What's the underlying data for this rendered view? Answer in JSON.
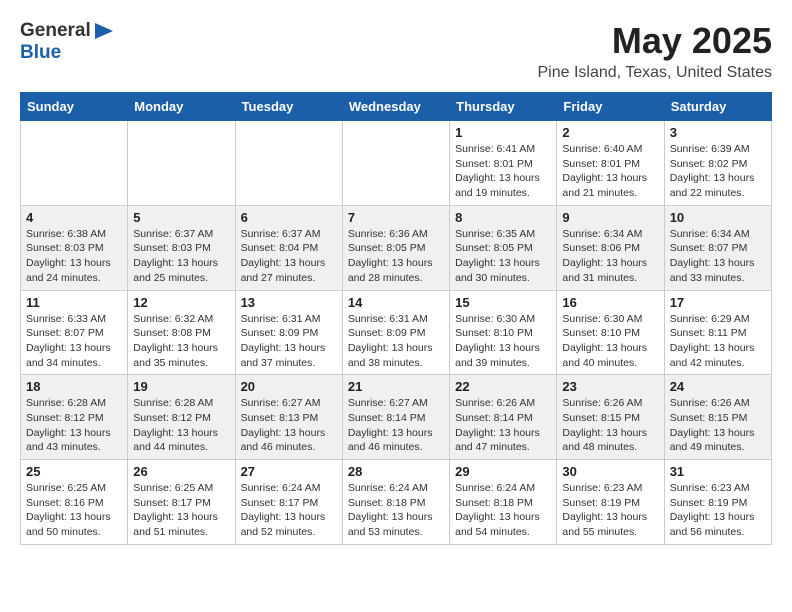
{
  "header": {
    "logo_general": "General",
    "logo_blue": "Blue",
    "title": "May 2025",
    "subtitle": "Pine Island, Texas, United States"
  },
  "weekdays": [
    "Sunday",
    "Monday",
    "Tuesday",
    "Wednesday",
    "Thursday",
    "Friday",
    "Saturday"
  ],
  "weeks": [
    [
      {
        "day": "",
        "info": ""
      },
      {
        "day": "",
        "info": ""
      },
      {
        "day": "",
        "info": ""
      },
      {
        "day": "",
        "info": ""
      },
      {
        "day": "1",
        "info": "Sunrise: 6:41 AM\nSunset: 8:01 PM\nDaylight: 13 hours\nand 19 minutes."
      },
      {
        "day": "2",
        "info": "Sunrise: 6:40 AM\nSunset: 8:01 PM\nDaylight: 13 hours\nand 21 minutes."
      },
      {
        "day": "3",
        "info": "Sunrise: 6:39 AM\nSunset: 8:02 PM\nDaylight: 13 hours\nand 22 minutes."
      }
    ],
    [
      {
        "day": "4",
        "info": "Sunrise: 6:38 AM\nSunset: 8:03 PM\nDaylight: 13 hours\nand 24 minutes."
      },
      {
        "day": "5",
        "info": "Sunrise: 6:37 AM\nSunset: 8:03 PM\nDaylight: 13 hours\nand 25 minutes."
      },
      {
        "day": "6",
        "info": "Sunrise: 6:37 AM\nSunset: 8:04 PM\nDaylight: 13 hours\nand 27 minutes."
      },
      {
        "day": "7",
        "info": "Sunrise: 6:36 AM\nSunset: 8:05 PM\nDaylight: 13 hours\nand 28 minutes."
      },
      {
        "day": "8",
        "info": "Sunrise: 6:35 AM\nSunset: 8:05 PM\nDaylight: 13 hours\nand 30 minutes."
      },
      {
        "day": "9",
        "info": "Sunrise: 6:34 AM\nSunset: 8:06 PM\nDaylight: 13 hours\nand 31 minutes."
      },
      {
        "day": "10",
        "info": "Sunrise: 6:34 AM\nSunset: 8:07 PM\nDaylight: 13 hours\nand 33 minutes."
      }
    ],
    [
      {
        "day": "11",
        "info": "Sunrise: 6:33 AM\nSunset: 8:07 PM\nDaylight: 13 hours\nand 34 minutes."
      },
      {
        "day": "12",
        "info": "Sunrise: 6:32 AM\nSunset: 8:08 PM\nDaylight: 13 hours\nand 35 minutes."
      },
      {
        "day": "13",
        "info": "Sunrise: 6:31 AM\nSunset: 8:09 PM\nDaylight: 13 hours\nand 37 minutes."
      },
      {
        "day": "14",
        "info": "Sunrise: 6:31 AM\nSunset: 8:09 PM\nDaylight: 13 hours\nand 38 minutes."
      },
      {
        "day": "15",
        "info": "Sunrise: 6:30 AM\nSunset: 8:10 PM\nDaylight: 13 hours\nand 39 minutes."
      },
      {
        "day": "16",
        "info": "Sunrise: 6:30 AM\nSunset: 8:10 PM\nDaylight: 13 hours\nand 40 minutes."
      },
      {
        "day": "17",
        "info": "Sunrise: 6:29 AM\nSunset: 8:11 PM\nDaylight: 13 hours\nand 42 minutes."
      }
    ],
    [
      {
        "day": "18",
        "info": "Sunrise: 6:28 AM\nSunset: 8:12 PM\nDaylight: 13 hours\nand 43 minutes."
      },
      {
        "day": "19",
        "info": "Sunrise: 6:28 AM\nSunset: 8:12 PM\nDaylight: 13 hours\nand 44 minutes."
      },
      {
        "day": "20",
        "info": "Sunrise: 6:27 AM\nSunset: 8:13 PM\nDaylight: 13 hours\nand 46 minutes."
      },
      {
        "day": "21",
        "info": "Sunrise: 6:27 AM\nSunset: 8:14 PM\nDaylight: 13 hours\nand 46 minutes."
      },
      {
        "day": "22",
        "info": "Sunrise: 6:26 AM\nSunset: 8:14 PM\nDaylight: 13 hours\nand 47 minutes."
      },
      {
        "day": "23",
        "info": "Sunrise: 6:26 AM\nSunset: 8:15 PM\nDaylight: 13 hours\nand 48 minutes."
      },
      {
        "day": "24",
        "info": "Sunrise: 6:26 AM\nSunset: 8:15 PM\nDaylight: 13 hours\nand 49 minutes."
      }
    ],
    [
      {
        "day": "25",
        "info": "Sunrise: 6:25 AM\nSunset: 8:16 PM\nDaylight: 13 hours\nand 50 minutes."
      },
      {
        "day": "26",
        "info": "Sunrise: 6:25 AM\nSunset: 8:17 PM\nDaylight: 13 hours\nand 51 minutes."
      },
      {
        "day": "27",
        "info": "Sunrise: 6:24 AM\nSunset: 8:17 PM\nDaylight: 13 hours\nand 52 minutes."
      },
      {
        "day": "28",
        "info": "Sunrise: 6:24 AM\nSunset: 8:18 PM\nDaylight: 13 hours\nand 53 minutes."
      },
      {
        "day": "29",
        "info": "Sunrise: 6:24 AM\nSunset: 8:18 PM\nDaylight: 13 hours\nand 54 minutes."
      },
      {
        "day": "30",
        "info": "Sunrise: 6:23 AM\nSunset: 8:19 PM\nDaylight: 13 hours\nand 55 minutes."
      },
      {
        "day": "31",
        "info": "Sunrise: 6:23 AM\nSunset: 8:19 PM\nDaylight: 13 hours\nand 56 minutes."
      }
    ]
  ]
}
